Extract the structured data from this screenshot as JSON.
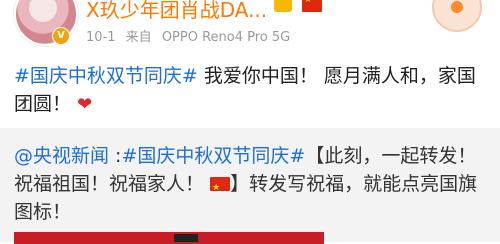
{
  "header": {
    "username": "X玖少年团肖战DA...",
    "date": "10-1",
    "source_prefix": "来自",
    "device": "OPPO Reno4 Pro 5G",
    "avatar_badge": "V"
  },
  "post": {
    "topic": "#国庆中秋双节同庆#",
    "body": " 我爱你中国！ 愿月满人和，家国团圆！",
    "emoji": "❤"
  },
  "repost": {
    "mention": "@央视新闻",
    "separator": " :",
    "topic": "#国庆中秋双节同庆#",
    "body_part1": "【此刻，一起转发！祝福祖国！祝福家人！",
    "body_part2": "】转发写祝福，就能点亮国旗图标！"
  },
  "colors": {
    "link": "#1e6fd9",
    "username": "#ff7a00",
    "repost_bg": "#f3f3f3",
    "flag_red": "#de2910"
  }
}
